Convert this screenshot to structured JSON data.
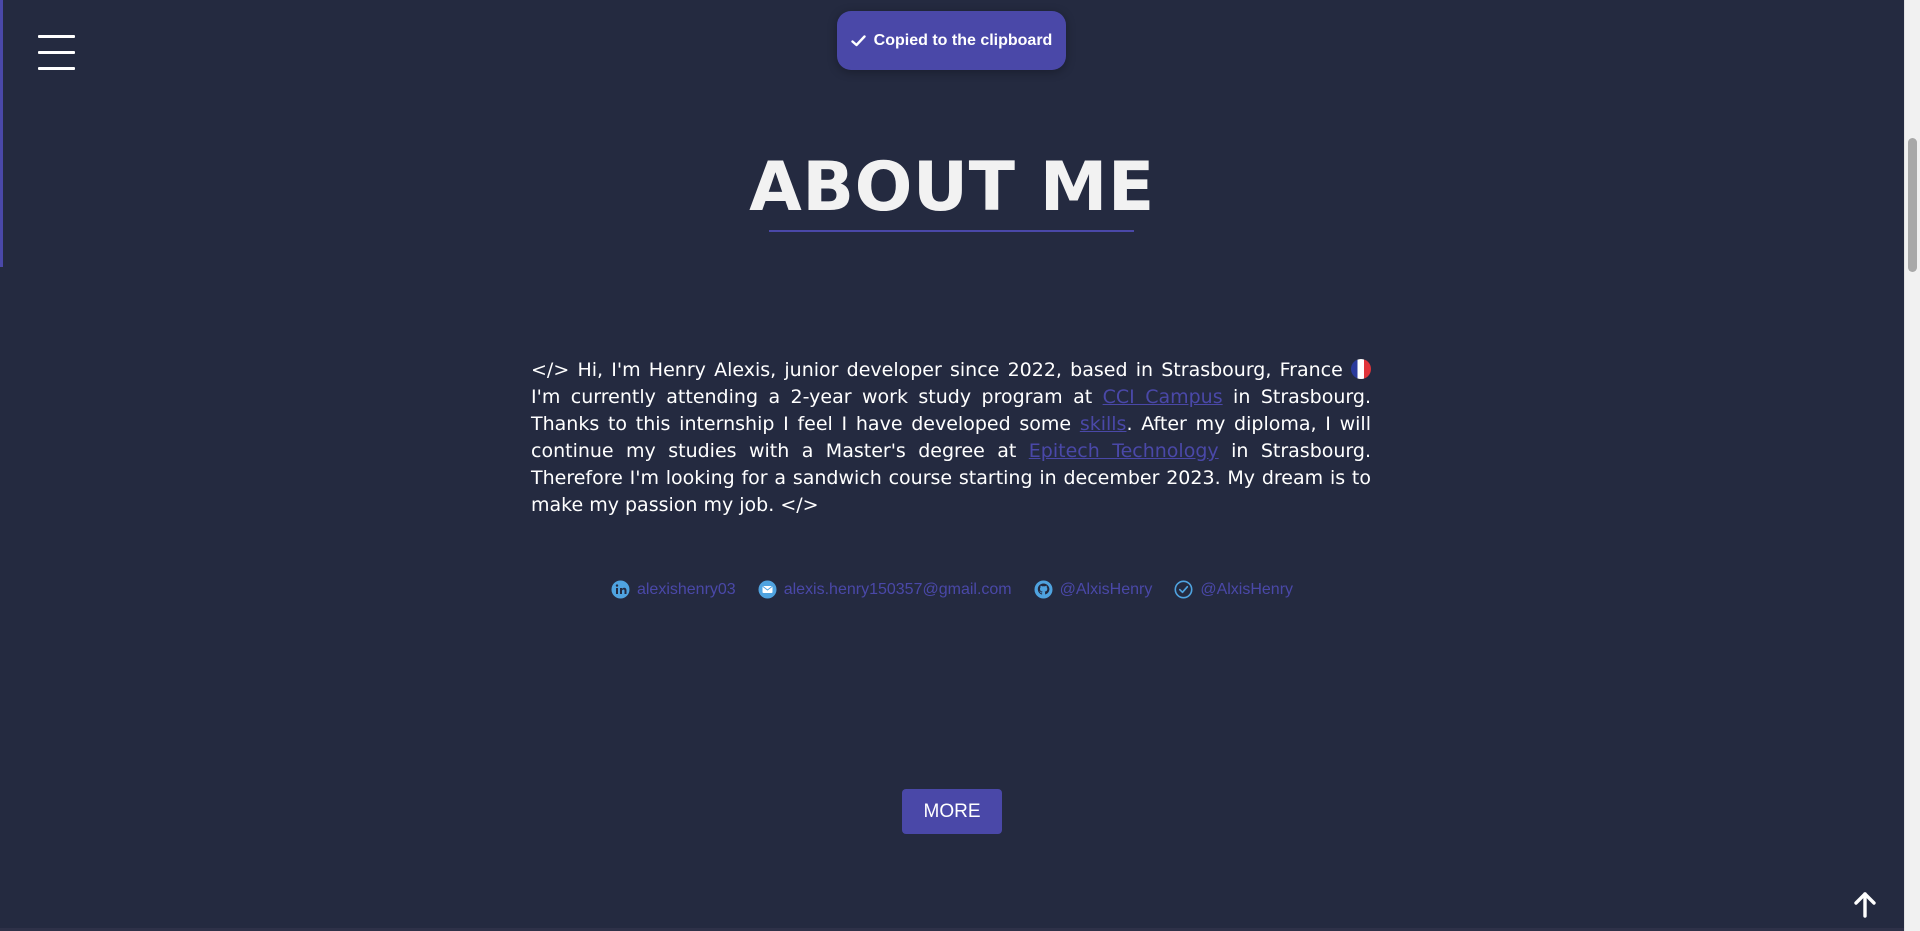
{
  "toast": {
    "message": "Copied to the clipboard",
    "icon": "check-icon"
  },
  "header": {
    "menu_icon": "hamburger-menu-icon"
  },
  "about": {
    "title": "ABOUT ME",
    "bio": {
      "part1": "</> Hi, I'm Henry Alexis, junior developer since 2022, based in Strasbourg, France ",
      "part2": " I'm currently attending a 2-year work study program at ",
      "link_cci": "CCI Campus",
      "part3": " in Strasbourg. Thanks to this internship I feel I have developed some ",
      "link_skills": "skills",
      "part4": ". After my diploma, I will continue my studies with a Master's degree at ",
      "link_epitech": "Epitech Technology",
      "part5": " in Strasbourg. Therefore I'm looking for a sandwich course starting in december 2023. My dream is to make my passion my job. </>"
    },
    "contacts": [
      {
        "icon": "linkedin-icon",
        "label": "alexishenry03"
      },
      {
        "icon": "mail-icon",
        "label": "alexis.henry150357@gmail.com"
      },
      {
        "icon": "github-icon",
        "label": "@AlxisHenry"
      },
      {
        "icon": "verified-icon",
        "label": "@AlxisHenry"
      }
    ],
    "more_label": "MORE"
  },
  "footer": {
    "back_to_top_icon": "arrow-up-icon"
  },
  "colors": {
    "background": "#242a40",
    "accent": "#4a48a8",
    "text": "#ffffff",
    "contact_icon": "#4fa3e0"
  }
}
